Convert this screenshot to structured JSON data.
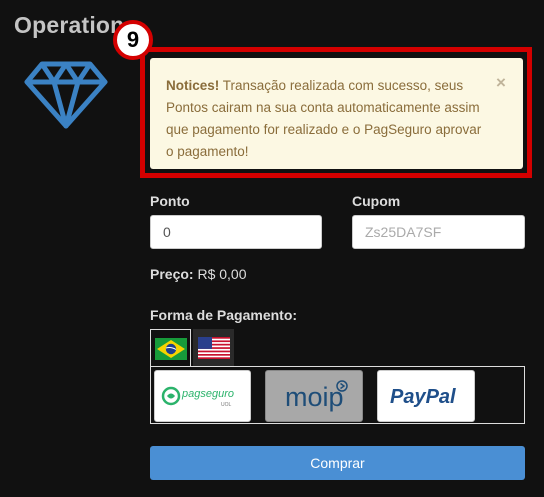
{
  "page": {
    "title": "Operation"
  },
  "step_badge": "9",
  "alert": {
    "heading": "Notices!",
    "message": "Transação realizada com sucesso, seus Pontos cairam na sua conta automaticamente assim que pagamento for realizado e o PagSeguro aprovar o pagamento!",
    "close": "×"
  },
  "form": {
    "ponto": {
      "label": "Ponto",
      "value": "0"
    },
    "cupom": {
      "label": "Cupom",
      "placeholder": "Zs25DA7SF"
    },
    "price": {
      "label": "Preço:",
      "value": "R$ 0,00"
    },
    "payment": {
      "label": "Forma de Pagamento:",
      "tabs": [
        {
          "name": "Brazil",
          "icon": "brazil-flag-icon",
          "active": true
        },
        {
          "name": "USA",
          "icon": "usa-flag-icon",
          "active": false
        }
      ],
      "methods": [
        {
          "logo_text": "pagseguro",
          "logo_subtext": "UOL",
          "icon": "pagseguro-logo"
        },
        {
          "logo_text": "moip",
          "icon": "moip-logo"
        },
        {
          "logo_text": "PayPal",
          "icon": "paypal-logo"
        }
      ]
    },
    "submit_label": "Comprar"
  },
  "colors": {
    "background": "#111111",
    "alert_bg": "#fcf8e3",
    "alert_text": "#8a6d3b",
    "highlight": "#d40000",
    "primary_button": "#4a8fd4",
    "diamond": "#3b82c4"
  }
}
